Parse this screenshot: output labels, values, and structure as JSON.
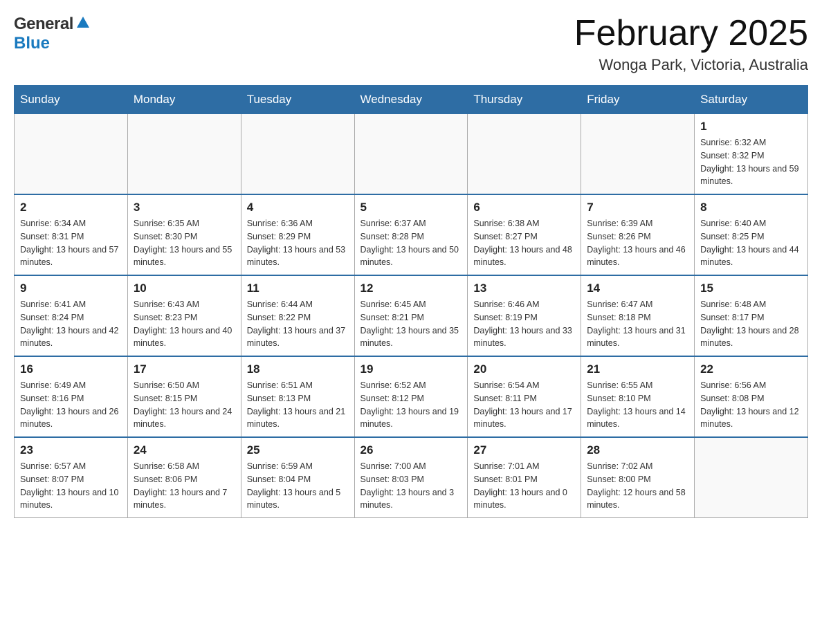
{
  "header": {
    "logo": {
      "general": "General",
      "blue": "Blue"
    },
    "title": "February 2025",
    "location": "Wonga Park, Victoria, Australia"
  },
  "days_of_week": [
    "Sunday",
    "Monday",
    "Tuesday",
    "Wednesday",
    "Thursday",
    "Friday",
    "Saturday"
  ],
  "weeks": [
    [
      {
        "day": "",
        "info": ""
      },
      {
        "day": "",
        "info": ""
      },
      {
        "day": "",
        "info": ""
      },
      {
        "day": "",
        "info": ""
      },
      {
        "day": "",
        "info": ""
      },
      {
        "day": "",
        "info": ""
      },
      {
        "day": "1",
        "info": "Sunrise: 6:32 AM\nSunset: 8:32 PM\nDaylight: 13 hours and 59 minutes."
      }
    ],
    [
      {
        "day": "2",
        "info": "Sunrise: 6:34 AM\nSunset: 8:31 PM\nDaylight: 13 hours and 57 minutes."
      },
      {
        "day": "3",
        "info": "Sunrise: 6:35 AM\nSunset: 8:30 PM\nDaylight: 13 hours and 55 minutes."
      },
      {
        "day": "4",
        "info": "Sunrise: 6:36 AM\nSunset: 8:29 PM\nDaylight: 13 hours and 53 minutes."
      },
      {
        "day": "5",
        "info": "Sunrise: 6:37 AM\nSunset: 8:28 PM\nDaylight: 13 hours and 50 minutes."
      },
      {
        "day": "6",
        "info": "Sunrise: 6:38 AM\nSunset: 8:27 PM\nDaylight: 13 hours and 48 minutes."
      },
      {
        "day": "7",
        "info": "Sunrise: 6:39 AM\nSunset: 8:26 PM\nDaylight: 13 hours and 46 minutes."
      },
      {
        "day": "8",
        "info": "Sunrise: 6:40 AM\nSunset: 8:25 PM\nDaylight: 13 hours and 44 minutes."
      }
    ],
    [
      {
        "day": "9",
        "info": "Sunrise: 6:41 AM\nSunset: 8:24 PM\nDaylight: 13 hours and 42 minutes."
      },
      {
        "day": "10",
        "info": "Sunrise: 6:43 AM\nSunset: 8:23 PM\nDaylight: 13 hours and 40 minutes."
      },
      {
        "day": "11",
        "info": "Sunrise: 6:44 AM\nSunset: 8:22 PM\nDaylight: 13 hours and 37 minutes."
      },
      {
        "day": "12",
        "info": "Sunrise: 6:45 AM\nSunset: 8:21 PM\nDaylight: 13 hours and 35 minutes."
      },
      {
        "day": "13",
        "info": "Sunrise: 6:46 AM\nSunset: 8:19 PM\nDaylight: 13 hours and 33 minutes."
      },
      {
        "day": "14",
        "info": "Sunrise: 6:47 AM\nSunset: 8:18 PM\nDaylight: 13 hours and 31 minutes."
      },
      {
        "day": "15",
        "info": "Sunrise: 6:48 AM\nSunset: 8:17 PM\nDaylight: 13 hours and 28 minutes."
      }
    ],
    [
      {
        "day": "16",
        "info": "Sunrise: 6:49 AM\nSunset: 8:16 PM\nDaylight: 13 hours and 26 minutes."
      },
      {
        "day": "17",
        "info": "Sunrise: 6:50 AM\nSunset: 8:15 PM\nDaylight: 13 hours and 24 minutes."
      },
      {
        "day": "18",
        "info": "Sunrise: 6:51 AM\nSunset: 8:13 PM\nDaylight: 13 hours and 21 minutes."
      },
      {
        "day": "19",
        "info": "Sunrise: 6:52 AM\nSunset: 8:12 PM\nDaylight: 13 hours and 19 minutes."
      },
      {
        "day": "20",
        "info": "Sunrise: 6:54 AM\nSunset: 8:11 PM\nDaylight: 13 hours and 17 minutes."
      },
      {
        "day": "21",
        "info": "Sunrise: 6:55 AM\nSunset: 8:10 PM\nDaylight: 13 hours and 14 minutes."
      },
      {
        "day": "22",
        "info": "Sunrise: 6:56 AM\nSunset: 8:08 PM\nDaylight: 13 hours and 12 minutes."
      }
    ],
    [
      {
        "day": "23",
        "info": "Sunrise: 6:57 AM\nSunset: 8:07 PM\nDaylight: 13 hours and 10 minutes."
      },
      {
        "day": "24",
        "info": "Sunrise: 6:58 AM\nSunset: 8:06 PM\nDaylight: 13 hours and 7 minutes."
      },
      {
        "day": "25",
        "info": "Sunrise: 6:59 AM\nSunset: 8:04 PM\nDaylight: 13 hours and 5 minutes."
      },
      {
        "day": "26",
        "info": "Sunrise: 7:00 AM\nSunset: 8:03 PM\nDaylight: 13 hours and 3 minutes."
      },
      {
        "day": "27",
        "info": "Sunrise: 7:01 AM\nSunset: 8:01 PM\nDaylight: 13 hours and 0 minutes."
      },
      {
        "day": "28",
        "info": "Sunrise: 7:02 AM\nSunset: 8:00 PM\nDaylight: 12 hours and 58 minutes."
      },
      {
        "day": "",
        "info": ""
      }
    ]
  ]
}
